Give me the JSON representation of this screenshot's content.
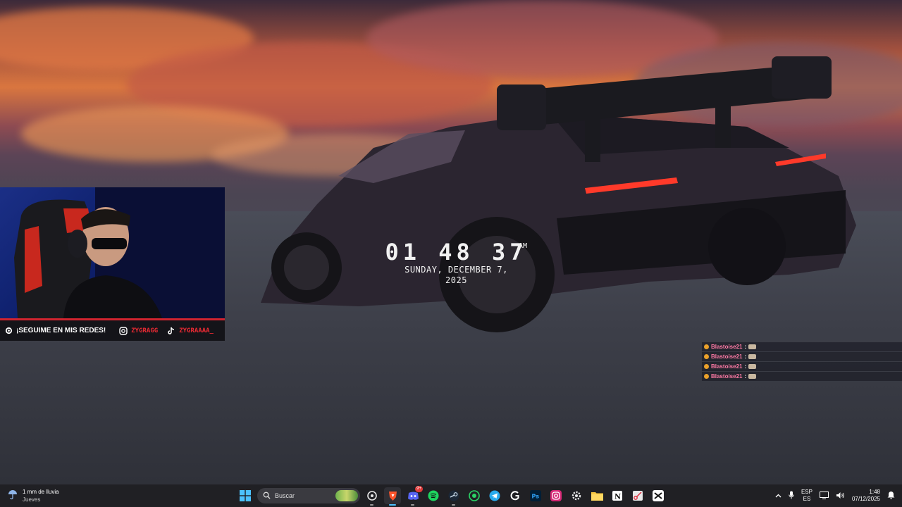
{
  "clock": {
    "time": "01 48 37",
    "ampm": "AM",
    "date_line": "SUNDAY, DECEMBER 7,",
    "year": "2025"
  },
  "webcam": {
    "social_label": "¡SEGUIME EN MIS REDES!",
    "instagram_handle": "ZYGRAGG",
    "tiktok_handle": "ZYGRAAAA_"
  },
  "chat": {
    "messages": [
      {
        "user": "Blastoise21",
        "sep": ":"
      },
      {
        "user": "Blastoise21",
        "sep": ":"
      },
      {
        "user": "Blastoise21",
        "sep": ":"
      },
      {
        "user": "Blastoise21",
        "sep": ":"
      }
    ]
  },
  "taskbar": {
    "weather_main": "1 mm de lluvia",
    "weather_sub": "Jueves",
    "search_placeholder": "Buscar",
    "discord_badge": "9+",
    "lang_top": "ESP",
    "lang_bottom": "ES",
    "time": "1:48",
    "date": "07/12/2025",
    "apps": [
      "windows-icon",
      "search",
      "chatgpt-icon",
      "brave-icon",
      "discord-icon",
      "spotify-icon",
      "steam-icon",
      "whatsapp-icon",
      "telegram-icon",
      "ghub-icon",
      "photoshop-icon",
      "instagram-icon",
      "settings-icon",
      "folder-icon",
      "notion-icon",
      "snipping-icon",
      "capcut-icon"
    ]
  },
  "colors": {
    "accent_red": "#d1242f",
    "chat_user": "#ff7aa5",
    "taskbar_bg": "#202024"
  }
}
